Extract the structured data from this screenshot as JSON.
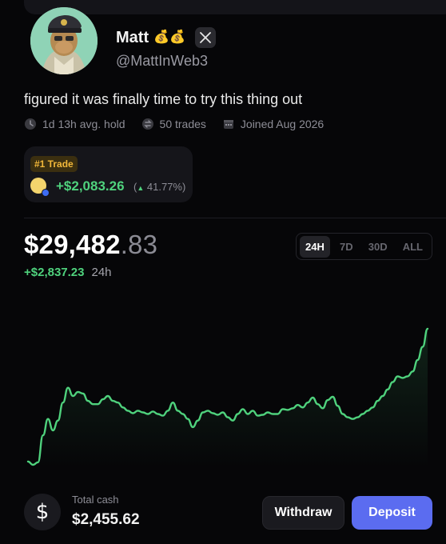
{
  "profile": {
    "name": "Matt",
    "name_emojis": "💰💰",
    "handle": "@MattInWeb3",
    "bio": "figured it was finally time to try this thing out",
    "avatar_icon": "ape-avatar-icon",
    "social_icon": "x-logo-icon"
  },
  "meta": {
    "hold": "1d 13h avg. hold",
    "trades": "50 trades",
    "joined": "Joined Aug 2026"
  },
  "top_trade": {
    "badge": "#1 Trade",
    "pnl": "+$2,083.26",
    "pct": "41.77%",
    "token_color": "#f3d46d"
  },
  "portfolio": {
    "balance_whole": "$29,482",
    "balance_cents": ".83",
    "change": "+$2,837.23",
    "change_period": "24h",
    "ranges": [
      "24H",
      "7D",
      "30D",
      "ALL"
    ],
    "active_range": "24H"
  },
  "chart_data": {
    "type": "line",
    "color": "#4fd27d",
    "values": [
      10,
      6,
      9,
      42,
      62,
      48,
      60,
      82,
      100,
      90,
      95,
      93,
      84,
      80,
      80,
      86,
      90,
      84,
      82,
      76,
      72,
      69,
      72,
      70,
      68,
      71,
      68,
      66,
      72,
      82,
      72,
      68,
      62,
      52,
      60,
      70,
      72,
      69,
      67,
      70,
      64,
      60,
      68,
      74,
      68,
      72,
      66,
      67,
      70,
      68,
      68,
      74,
      73,
      75,
      79,
      76,
      82,
      88,
      80,
      75,
      85,
      89,
      78,
      68,
      64,
      62,
      64,
      68,
      72,
      76,
      84,
      90,
      98,
      107,
      114,
      112,
      114,
      120,
      134,
      150,
      172
    ],
    "color_accent": "#4fd27d"
  },
  "cash": {
    "label": "Total cash",
    "value": "$2,455.62",
    "icon_glyph": "$"
  },
  "actions": {
    "withdraw": "Withdraw",
    "deposit": "Deposit"
  }
}
